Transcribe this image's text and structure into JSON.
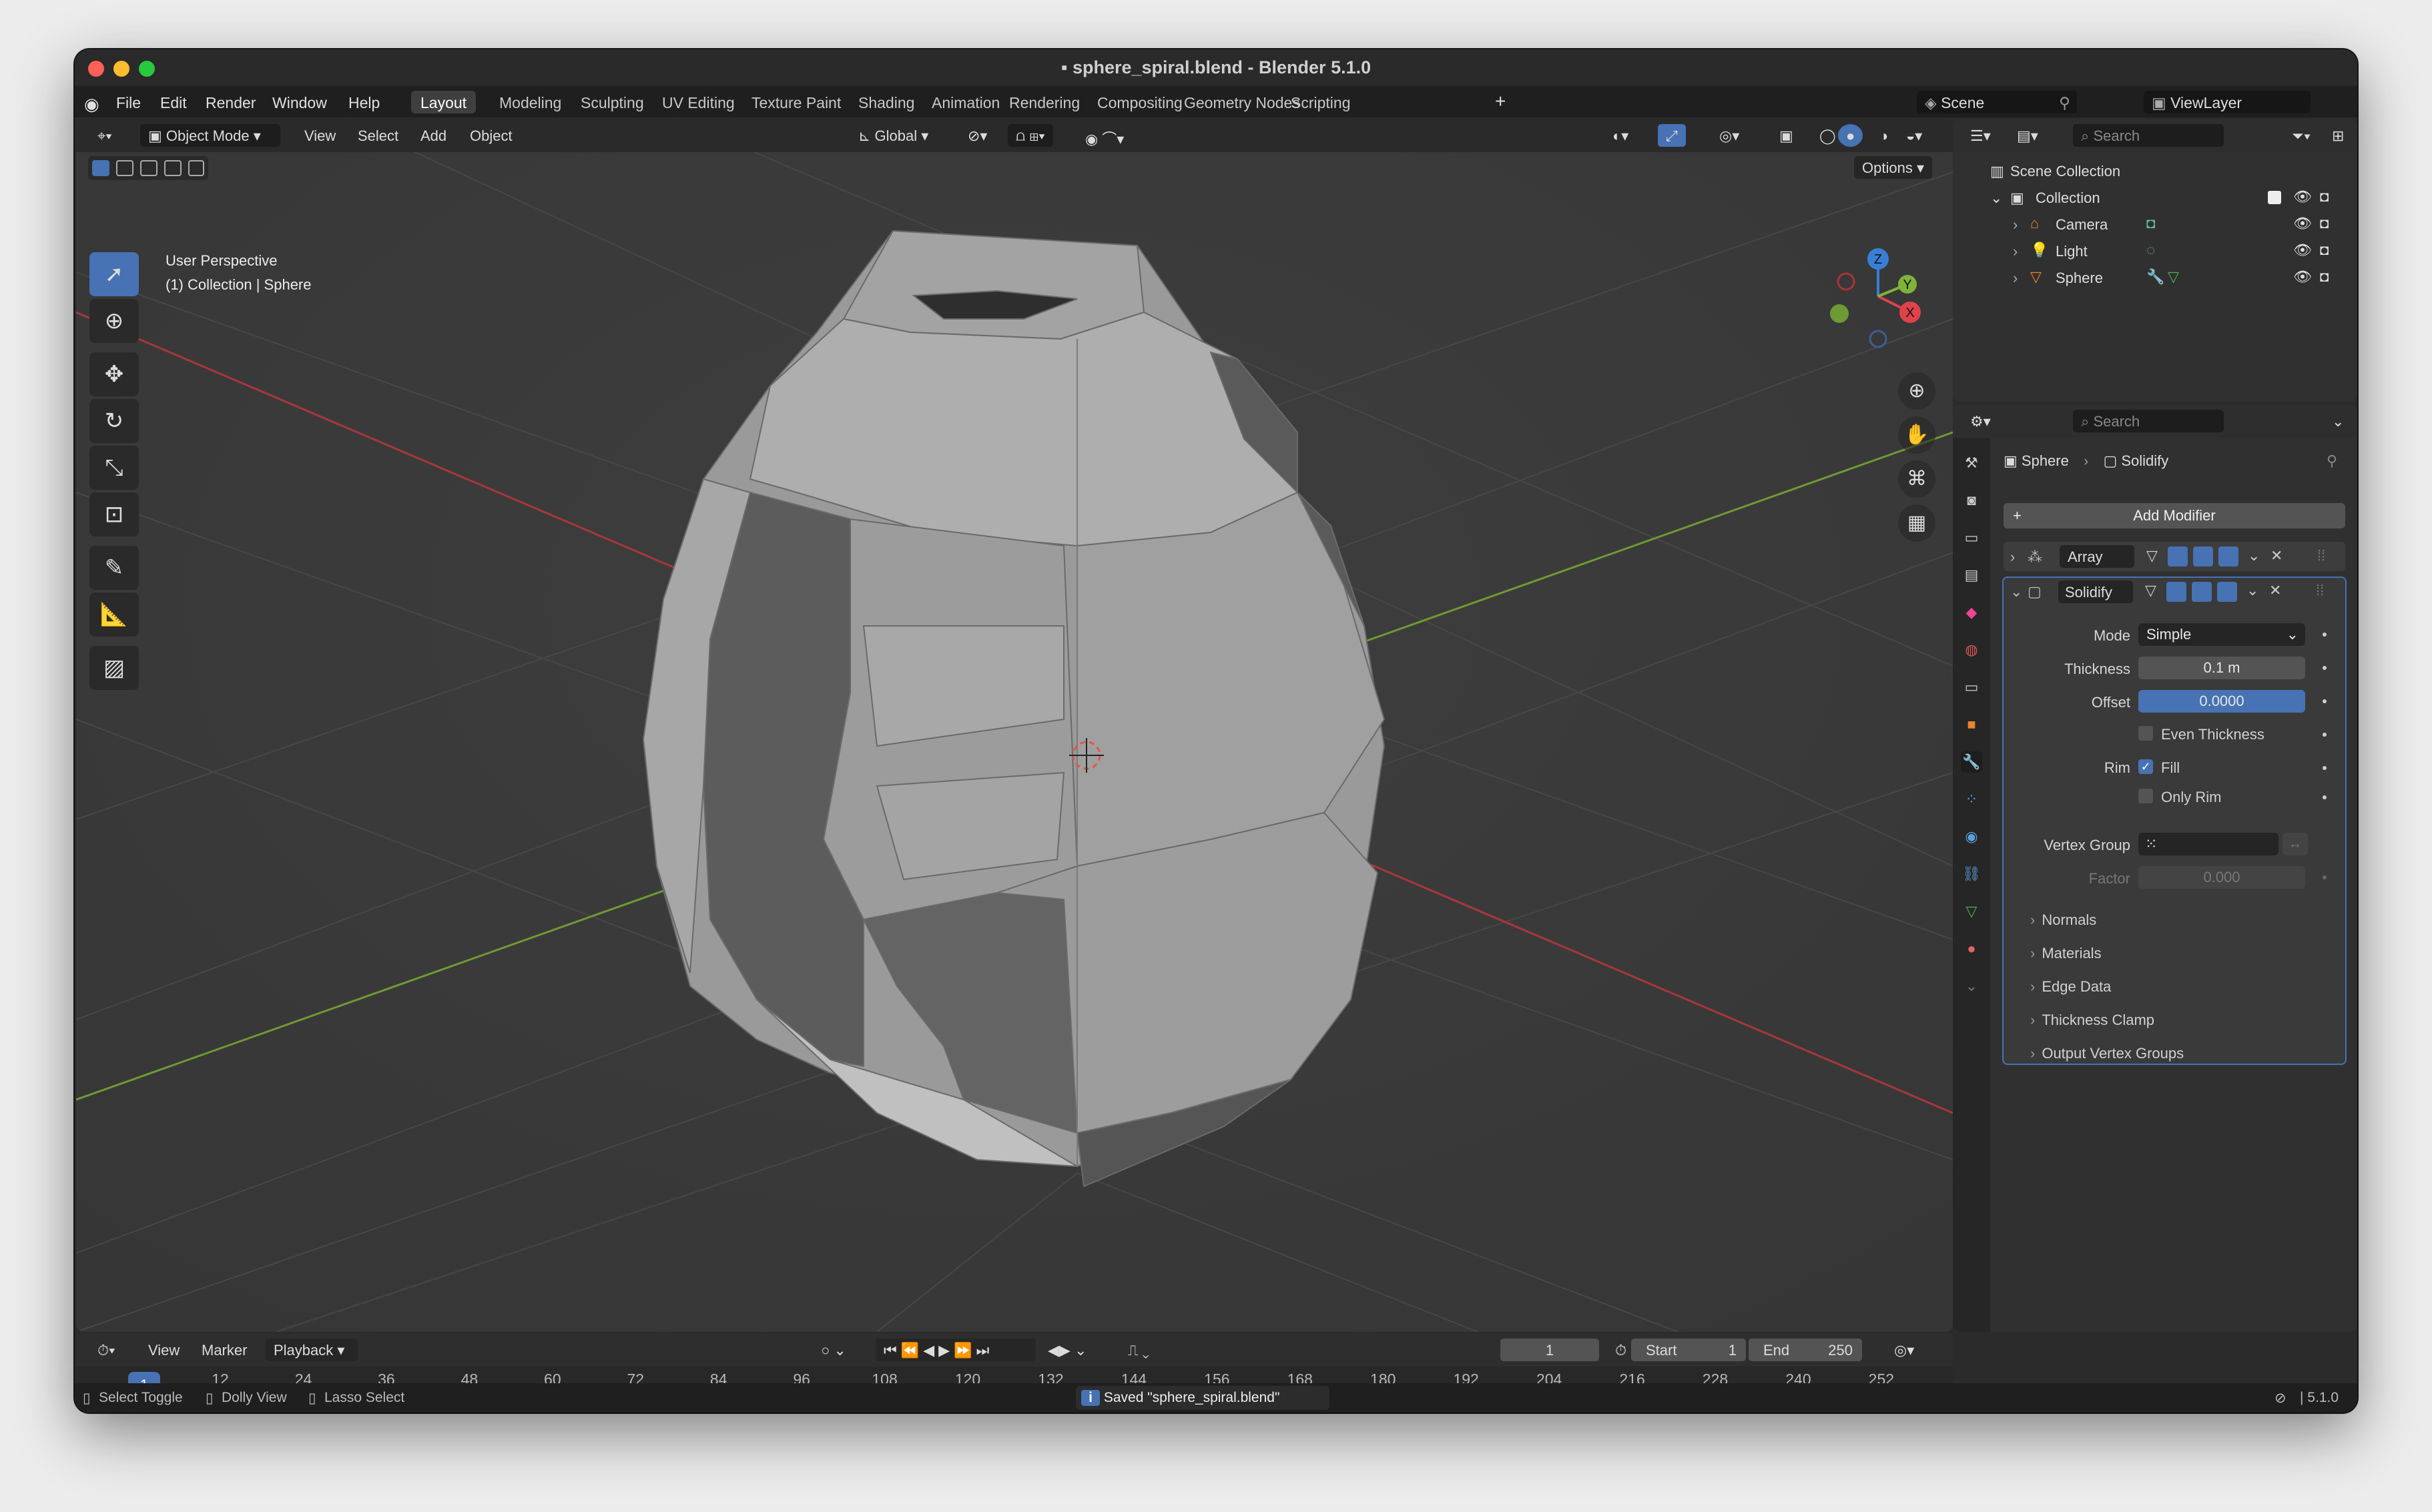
{
  "window": {
    "title": "sphere_spiral.blend - Blender 5.1.0"
  },
  "menu": {
    "file": "File",
    "edit": "Edit",
    "render": "Render",
    "window": "Window",
    "help": "Help"
  },
  "workspaces": [
    "Layout",
    "Modeling",
    "Sculpting",
    "UV Editing",
    "Texture Paint",
    "Shading",
    "Animation",
    "Rendering",
    "Compositing",
    "Geometry Nodes",
    "Scripting"
  ],
  "scene": {
    "name": "Scene",
    "view_layer": "ViewLayer"
  },
  "viewport_header": {
    "mode": "Object Mode",
    "view": "View",
    "select": "Select",
    "add": "Add",
    "object": "Object",
    "orientation": "Global",
    "options": "Options"
  },
  "viewport_overlay": {
    "perspective": "User Perspective",
    "context": "(1) Collection | Sphere"
  },
  "gizmo": {
    "x": "X",
    "y": "Y",
    "z": "Z"
  },
  "outliner": {
    "search_placeholder": "Search",
    "scene_collection": "Scene Collection",
    "collection": "Collection",
    "items": [
      "Camera",
      "Light",
      "Sphere"
    ]
  },
  "properties": {
    "search_placeholder": "Search",
    "breadcrumb_object": "Sphere",
    "breadcrumb_modifier": "Solidify",
    "add_modifier": "Add Modifier",
    "modifiers": [
      {
        "name": "Array",
        "expanded": false
      },
      {
        "name": "Solidify",
        "expanded": true
      }
    ],
    "mode_label": "Mode",
    "mode_value": "Simple",
    "thickness_label": "Thickness",
    "thickness_value": "0.1 m",
    "offset_label": "Offset",
    "offset_value": "0.0000",
    "even_thickness": "Even Thickness",
    "rim_label": "Rim",
    "fill": "Fill",
    "only_rim": "Only Rim",
    "vertex_group_label": "Vertex Group",
    "factor_label": "Factor",
    "factor_value": "0.000",
    "subpanels": [
      "Normals",
      "Materials",
      "Edge Data",
      "Thickness Clamp",
      "Output Vertex Groups"
    ]
  },
  "timeline": {
    "view": "View",
    "marker": "Marker",
    "playback": "Playback",
    "current_frame": "1",
    "start_label": "Start",
    "start": "1",
    "end_label": "End",
    "end": "250",
    "ticks": [
      "1",
      "12",
      "24",
      "36",
      "48",
      "60",
      "72",
      "84",
      "96",
      "108",
      "120",
      "132",
      "144",
      "156",
      "168",
      "180",
      "192",
      "204",
      "216",
      "228",
      "240",
      "252"
    ]
  },
  "statusbar": {
    "select_toggle": "Select Toggle",
    "dolly_view": "Dolly View",
    "lasso_select": "Lasso Select",
    "message": "Saved \"sphere_spiral.blend\"",
    "version": "5.1.0"
  },
  "colors": {
    "accent": "#4772b3",
    "x_axis": "#e0424b",
    "y_axis": "#7fb33a",
    "z_axis": "#3a7fd6"
  }
}
